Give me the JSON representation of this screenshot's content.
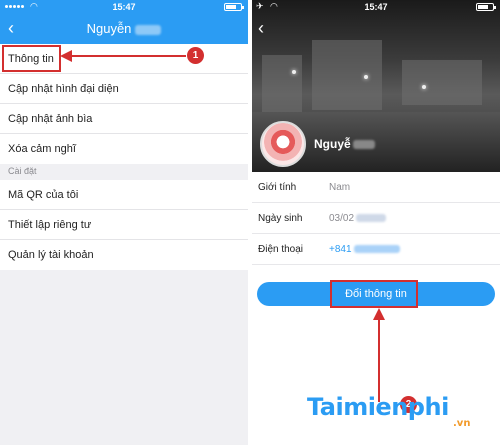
{
  "left": {
    "status": {
      "time": "15:47"
    },
    "nav": {
      "back_icon": "chevron-left-icon",
      "title": "Nguyễn"
    },
    "menu_primary": [
      {
        "label": "Thông tin"
      },
      {
        "label": "Cập nhật hình đại diện"
      },
      {
        "label": "Cập nhật ảnh bìa"
      },
      {
        "label": "Xóa cảm nghĩ"
      }
    ],
    "section_label": "Cài đặt",
    "menu_settings": [
      {
        "label": "Mã QR của tôi"
      },
      {
        "label": "Thiết lập riêng tư"
      },
      {
        "label": "Quản lý tài khoản"
      }
    ],
    "step_badge": "1"
  },
  "right": {
    "status": {
      "time": "15:47"
    },
    "profile_name": "Nguyễ",
    "info": [
      {
        "label": "Giới tính",
        "value": "Nam"
      },
      {
        "label": "Ngày sinh",
        "value": "03/02"
      },
      {
        "label": "Điện thoại",
        "value": "+841"
      }
    ],
    "action_button": "Đổi thông tin",
    "step_badge": "2"
  },
  "watermark": {
    "main": "Taimienphi",
    "suffix": ".vn"
  },
  "colors": {
    "accent": "#2b9cf3",
    "highlight": "#d32f2f",
    "watermark_suffix": "#f29b2c"
  }
}
